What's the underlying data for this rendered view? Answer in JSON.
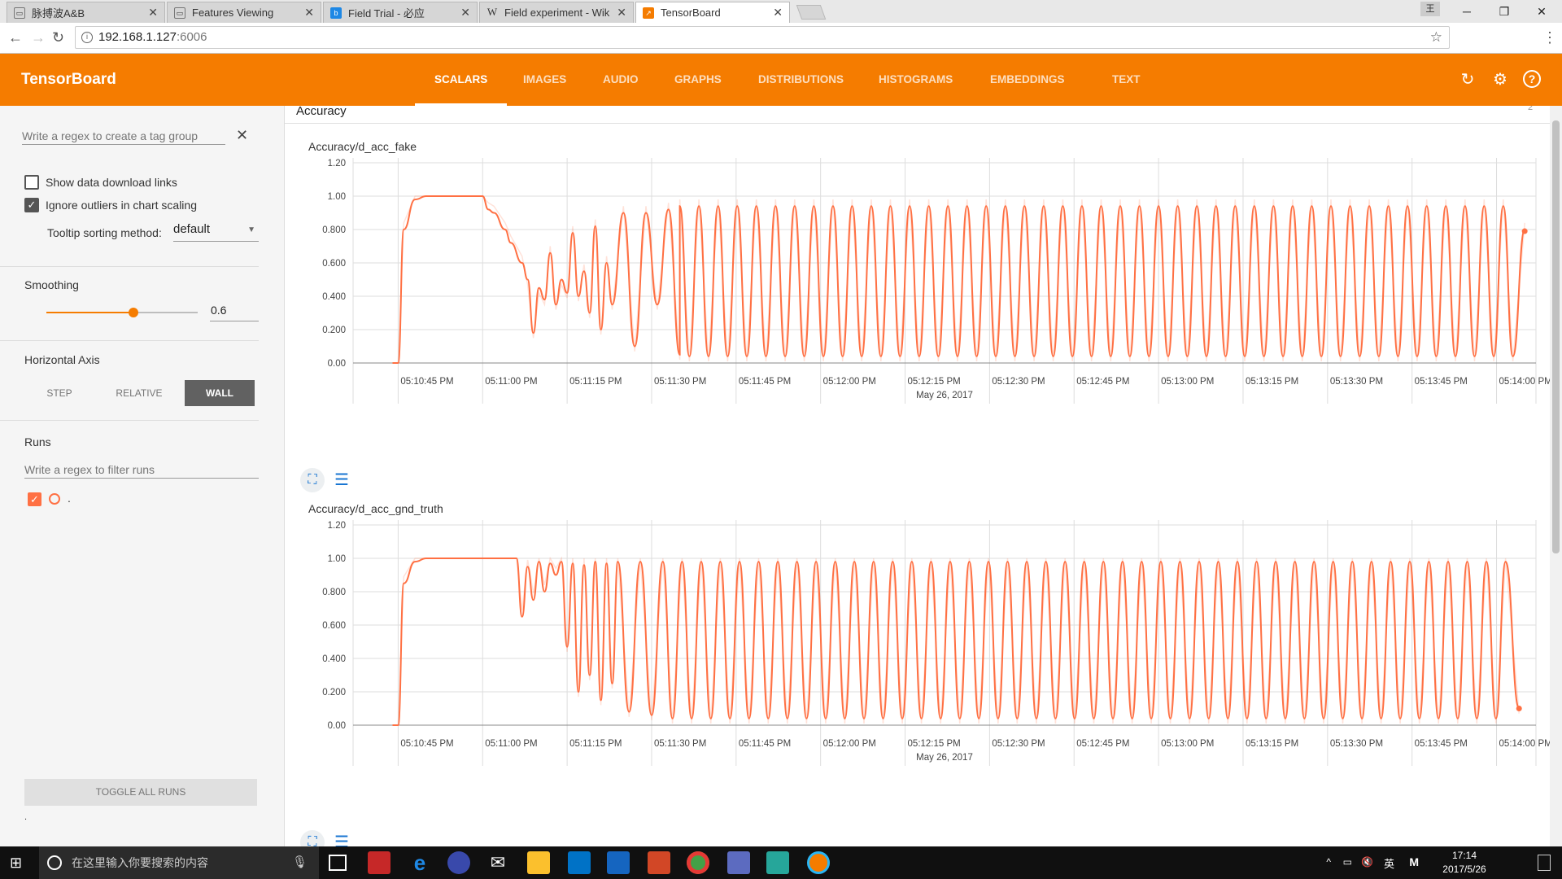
{
  "browser": {
    "tabs": [
      {
        "title": "脉搏波A&B",
        "icon": "document-icon"
      },
      {
        "title": "Features Viewing",
        "icon": "document-icon"
      },
      {
        "title": "Field Trial - 必应",
        "icon": "bing-icon"
      },
      {
        "title": "Field experiment - Wik",
        "icon": "wikipedia-icon"
      },
      {
        "title": "TensorBoard",
        "icon": "tensorboard-icon"
      }
    ],
    "url_host": "192.168.1.127",
    "url_port": ":6006",
    "ime_indicator": "王"
  },
  "header": {
    "title": "TensorBoard",
    "tabs": [
      "SCALARS",
      "IMAGES",
      "AUDIO",
      "GRAPHS",
      "DISTRIBUTIONS",
      "HISTOGRAMS",
      "EMBEDDINGS",
      "TEXT"
    ],
    "active_tab": "SCALARS"
  },
  "sidebar": {
    "tag_regex_placeholder": "Write a regex to create a tag group",
    "show_download_label": "Show data download links",
    "ignore_outliers_label": "Ignore outliers in chart scaling",
    "show_download_checked": false,
    "ignore_outliers_checked": true,
    "tooltip_label": "Tooltip sorting method:",
    "tooltip_value": "default",
    "smoothing_label": "Smoothing",
    "smoothing_value": "0.6",
    "smoothing_fraction": 0.6,
    "horizontal_axis_label": "Horizontal Axis",
    "axis_options": [
      "STEP",
      "RELATIVE",
      "WALL"
    ],
    "axis_selected": "WALL",
    "runs_label": "Runs",
    "runs_filter_placeholder": "Write a regex to filter runs",
    "run_name": ".",
    "toggle_all_label": "TOGGLE ALL RUNS",
    "footer_dot": "."
  },
  "main": {
    "section_title": "Accuracy",
    "section_count": "2"
  },
  "chart_data": [
    {
      "type": "line",
      "title": "Accuracy/d_acc_fake",
      "xlabel": "May 26, 2017",
      "x_ticks": [
        "05:10:45 PM",
        "05:11:00 PM",
        "05:11:15 PM",
        "05:11:30 PM",
        "05:11:45 PM",
        "05:12:00 PM",
        "05:12:15 PM",
        "05:12:30 PM",
        "05:12:45 PM",
        "05:13:00 PM",
        "05:13:15 PM",
        "05:13:30 PM",
        "05:13:45 PM",
        "05:14:00 PM"
      ],
      "y_ticks": [
        "0.00",
        "0.200",
        "0.400",
        "0.600",
        "0.800",
        "1.00",
        "1.20"
      ],
      "xlim": [
        "05:10:37 PM",
        "05:14:07 PM"
      ],
      "ylim": [
        0,
        1.2
      ],
      "color": "#ff7043",
      "smoothing": 0.6,
      "series": [
        {
          "x": [
            "05:10:44 PM",
            "05:10:45 PM",
            "05:10:46 PM",
            "05:10:48 PM",
            "05:10:50 PM",
            "05:10:53 PM",
            "05:10:56 PM",
            "05:10:58 PM",
            "05:11:00 PM",
            "05:11:01 PM",
            "05:11:02 PM",
            "05:11:04 PM",
            "05:11:05 PM",
            "05:11:07 PM",
            "05:11:08 PM",
            "05:11:09 PM",
            "05:11:10 PM",
            "05:11:11 PM",
            "05:11:12 PM",
            "05:11:13 PM",
            "05:11:14 PM",
            "05:11:15 PM",
            "05:11:16 PM",
            "05:11:17 PM",
            "05:11:18 PM",
            "05:11:19 PM",
            "05:11:20 PM",
            "05:11:21 PM",
            "05:11:22 PM",
            "05:11:23 PM",
            "05:11:25 PM",
            "05:11:27 PM",
            "05:11:29 PM",
            "05:11:31 PM",
            "05:11:33 PM",
            "05:11:35 PM",
            "05:14:05 PM"
          ],
          "y": [
            0.0,
            0.0,
            0.8,
            0.98,
            1.0,
            1.0,
            1.0,
            1.0,
            1.0,
            0.92,
            0.9,
            0.8,
            0.72,
            0.6,
            0.5,
            0.18,
            0.45,
            0.38,
            0.66,
            0.35,
            0.5,
            0.42,
            0.78,
            0.4,
            0.55,
            0.3,
            0.82,
            0.2,
            0.6,
            0.35,
            0.9,
            0.1,
            0.9,
            0.35,
            0.92,
            0.05,
            0.8
          ],
          "oscillation": {
            "from": "05:11:35 PM",
            "to": "05:14:03 PM",
            "low": 0.04,
            "high": 0.94,
            "period_seconds": 3.4
          },
          "last_point": {
            "x": "05:14:05 PM",
            "y": 0.79
          }
        }
      ]
    },
    {
      "type": "line",
      "title": "Accuracy/d_acc_gnd_truth",
      "xlabel": "May 26, 2017",
      "x_ticks": [
        "05:10:45 PM",
        "05:11:00 PM",
        "05:11:15 PM",
        "05:11:30 PM",
        "05:11:45 PM",
        "05:12:00 PM",
        "05:12:15 PM",
        "05:12:30 PM",
        "05:12:45 PM",
        "05:13:00 PM",
        "05:13:15 PM",
        "05:13:30 PM",
        "05:13:45 PM",
        "05:14:00 PM"
      ],
      "y_ticks": [
        "0.00",
        "0.200",
        "0.400",
        "0.600",
        "0.800",
        "1.00",
        "1.20"
      ],
      "xlim": [
        "05:10:37 PM",
        "05:14:07 PM"
      ],
      "ylim": [
        0,
        1.2
      ],
      "color": "#ff7043",
      "smoothing": 0.6,
      "series": [
        {
          "x": [
            "05:10:44 PM",
            "05:10:45 PM",
            "05:10:46 PM",
            "05:10:48 PM",
            "05:10:50 PM",
            "05:11:00 PM",
            "05:11:06 PM",
            "05:11:07 PM",
            "05:11:08 PM",
            "05:11:09 PM",
            "05:11:10 PM",
            "05:11:11 PM",
            "05:11:12 PM",
            "05:11:13 PM",
            "05:11:14 PM",
            "05:11:15 PM",
            "05:11:16 PM",
            "05:11:17 PM",
            "05:11:18 PM",
            "05:11:19 PM",
            "05:11:20 PM",
            "05:11:21 PM",
            "05:11:22 PM",
            "05:11:23 PM",
            "05:11:24 PM",
            "05:11:26 PM",
            "05:11:28 PM",
            "05:11:30 PM",
            "05:11:32 PM",
            "05:14:04 PM"
          ],
          "y": [
            0.0,
            0.0,
            0.85,
            0.98,
            1.0,
            1.0,
            1.0,
            0.65,
            0.95,
            0.75,
            0.98,
            0.8,
            0.97,
            0.9,
            0.98,
            0.47,
            0.97,
            0.2,
            0.96,
            0.3,
            0.98,
            0.15,
            0.97,
            0.25,
            0.98,
            0.08,
            0.98,
            0.06,
            0.98,
            0.1
          ],
          "oscillation": {
            "from": "05:11:32 PM",
            "to": "05:14:03 PM",
            "low": 0.04,
            "high": 0.98,
            "period_seconds": 3.4
          },
          "last_point": {
            "x": "05:14:04 PM",
            "y": 0.1
          }
        }
      ]
    }
  ],
  "taskbar": {
    "search_placeholder": "在这里输入你要搜索的内容",
    "time": "17:14",
    "date": "2017/5/26",
    "ime_lang": "英",
    "ime_mode": "M"
  }
}
